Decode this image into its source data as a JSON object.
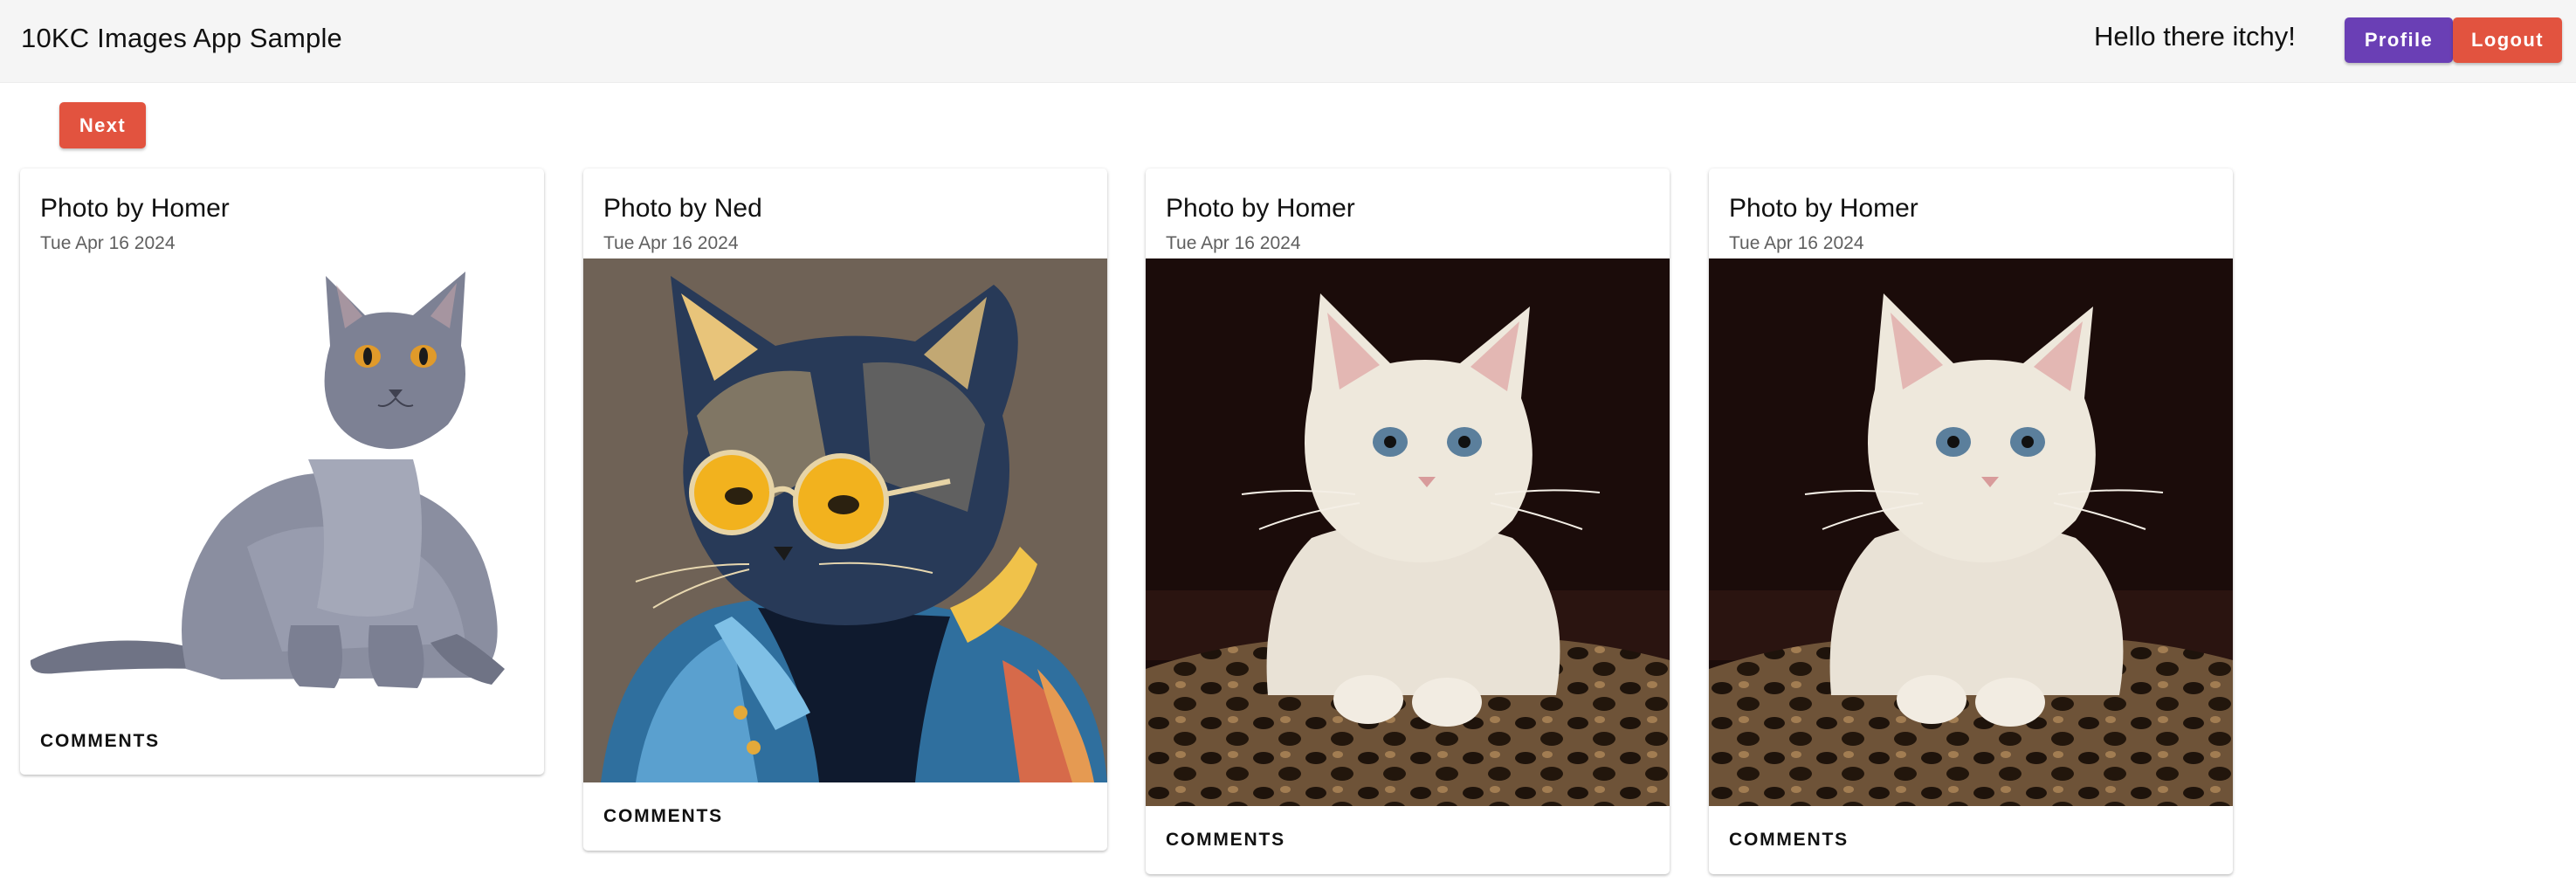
{
  "app": {
    "title": "10KC Images App Sample",
    "greeting": "Hello there itchy!",
    "profile_label": "Profile",
    "logout_label": "Logout",
    "next_label": "Next"
  },
  "colors": {
    "appbar_bg": "#f5f5f5",
    "profile_button": "#6a3fb5",
    "logout_button": "#e2533f",
    "next_button": "#e2533f"
  },
  "cards": [
    {
      "title": "Photo by Homer",
      "date": "Tue Apr 16 2024",
      "comments_label": "COMMENTS",
      "image": "gray-cat-photo"
    },
    {
      "title": "Photo by Ned",
      "date": "Tue Apr 16 2024",
      "comments_label": "COMMENTS",
      "image": "cat-with-sunglasses-illustration"
    },
    {
      "title": "Photo by Homer",
      "date": "Tue Apr 16 2024",
      "comments_label": "COMMENTS",
      "image": "white-kitten-photo"
    },
    {
      "title": "Photo by Homer",
      "date": "Tue Apr 16 2024",
      "comments_label": "COMMENTS",
      "image": "white-kitten-photo"
    }
  ]
}
